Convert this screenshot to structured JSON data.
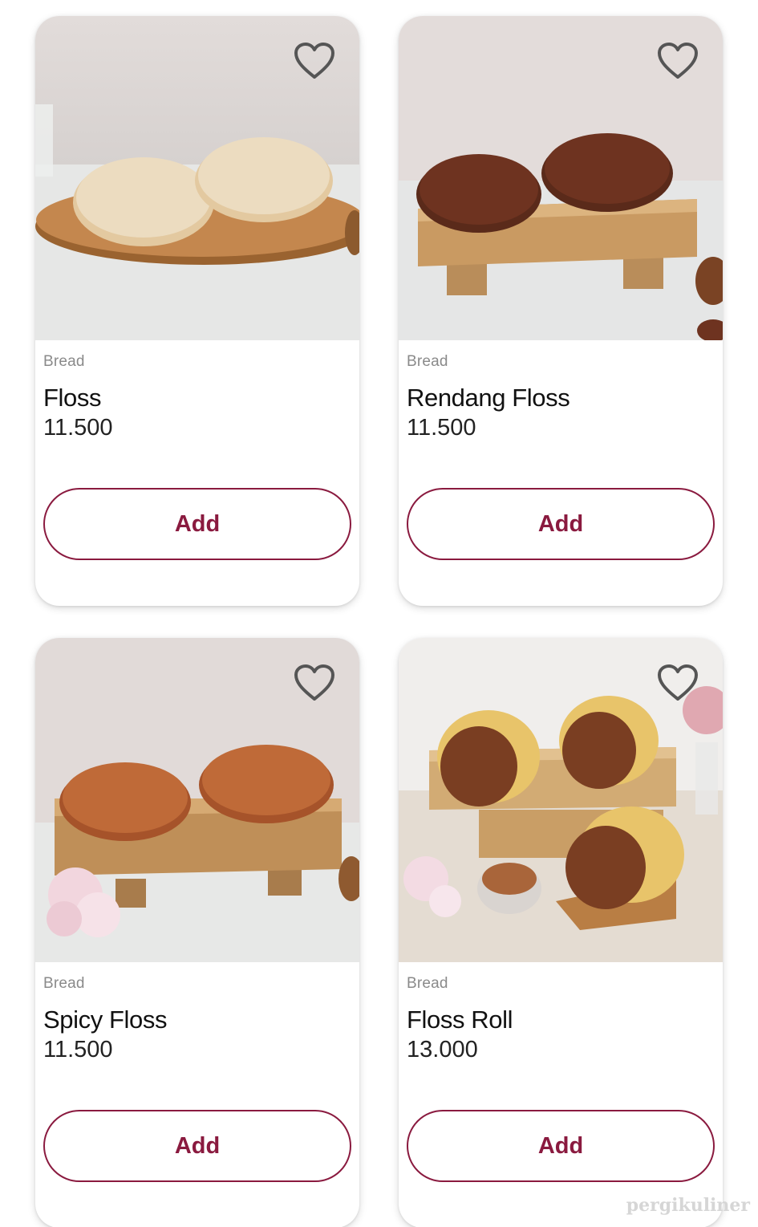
{
  "products": [
    {
      "category": "Bread",
      "name": "Floss",
      "price": "11.500",
      "add_label": "Add",
      "favorite_icon": "heart-outline-icon"
    },
    {
      "category": "Bread",
      "name": "Rendang Floss",
      "price": "11.500",
      "add_label": "Add",
      "favorite_icon": "heart-outline-icon"
    },
    {
      "category": "Bread",
      "name": "Spicy Floss",
      "price": "11.500",
      "add_label": "Add",
      "favorite_icon": "heart-outline-icon"
    },
    {
      "category": "Bread",
      "name": "Floss Roll",
      "price": "13.000",
      "add_label": "Add",
      "favorite_icon": "heart-outline-icon"
    }
  ],
  "watermark": "pergikuliner",
  "colors": {
    "accent": "#8a1a3f",
    "category_text": "#8a8a8a",
    "heart": "#555555"
  }
}
